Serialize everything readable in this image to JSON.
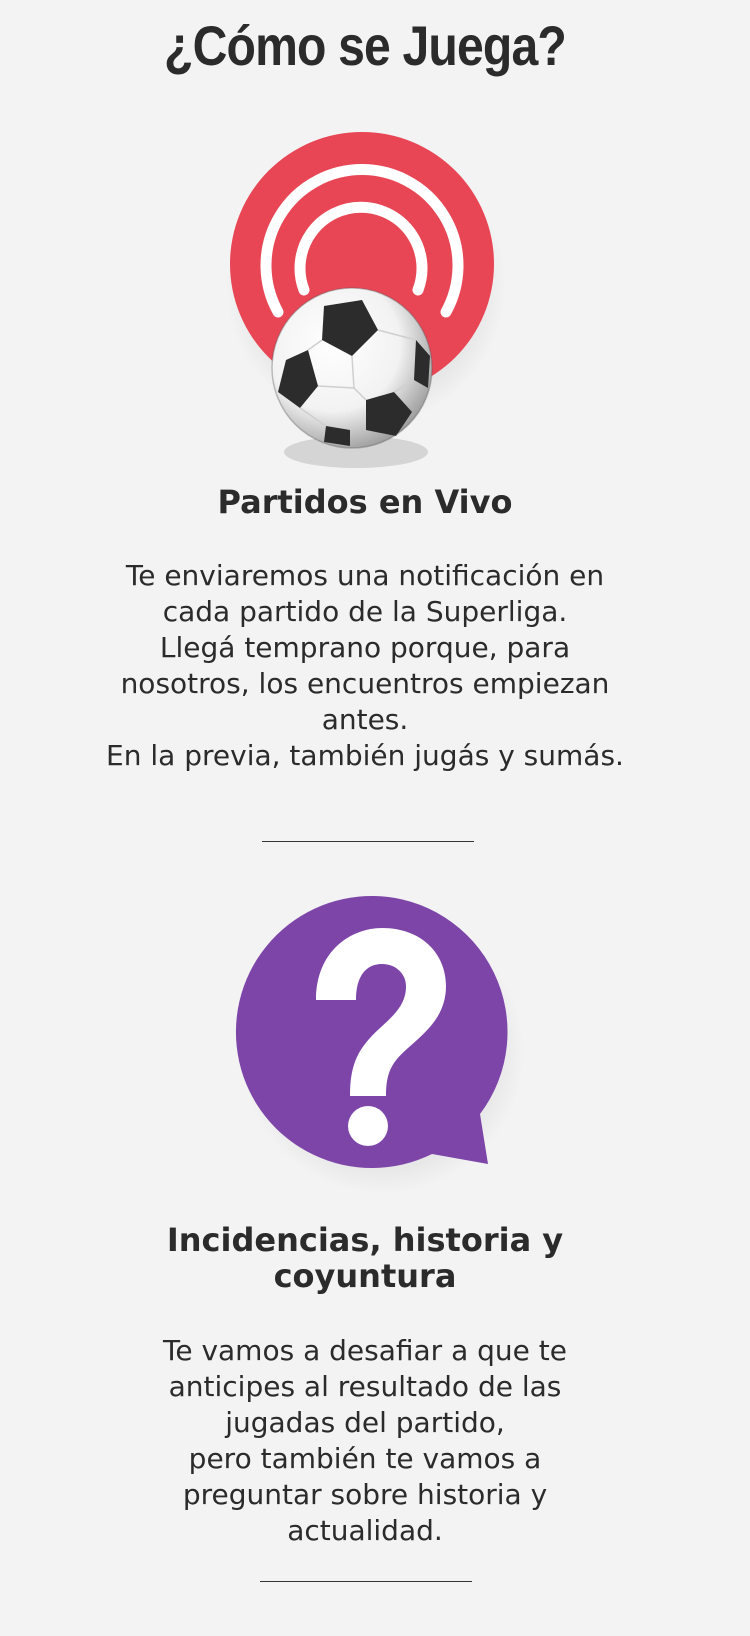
{
  "page": {
    "title": "¿Cómo se Juega?"
  },
  "sections": [
    {
      "icon": "live-broadcast-soccer-ball-icon",
      "icon_color": "#e84655",
      "title": "Partidos en Vivo",
      "lines": [
        "Te enviaremos una notificación en",
        "cada partido de la Superliga.",
        "Llegá temprano porque, para",
        "nosotros, los encuentros empiezan",
        "antes.",
        "En la previa, también jugás y sumás."
      ]
    },
    {
      "icon": "question-speech-bubble-icon",
      "icon_color": "#7d45a8",
      "title_lines": [
        "Incidencias, historia y",
        "coyuntura"
      ],
      "lines": [
        "Te vamos a desafiar a que te",
        "anticipes al resultado de las",
        "jugadas del partido,",
        "pero también te vamos a",
        "preguntar sobre historia y",
        "actualidad."
      ]
    }
  ]
}
